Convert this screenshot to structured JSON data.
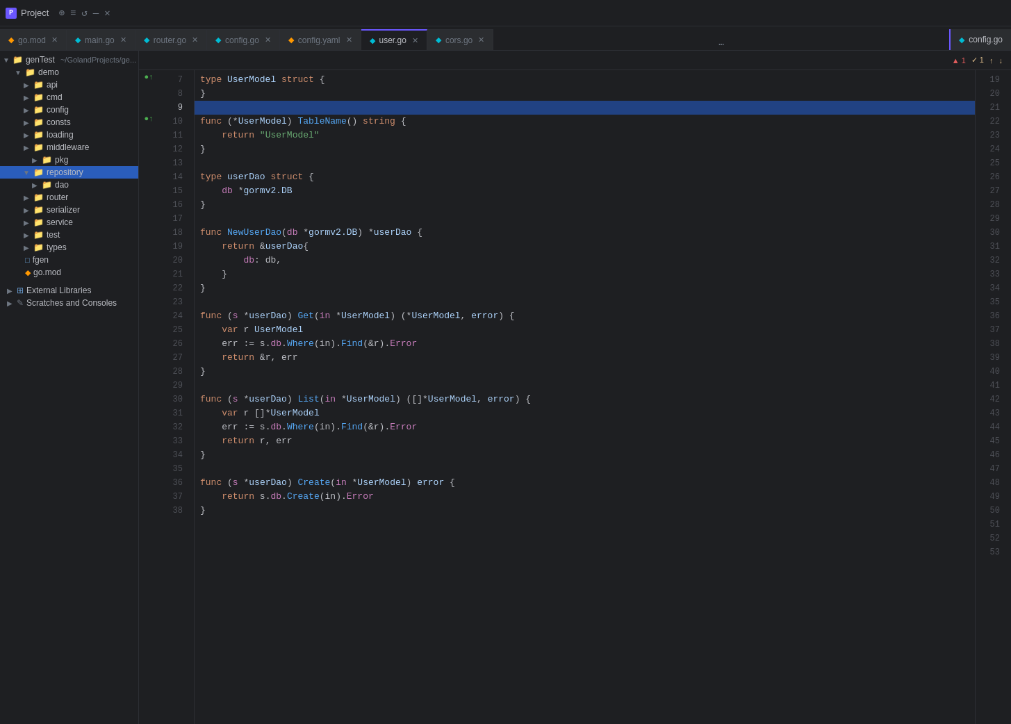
{
  "titleBar": {
    "projectIcon": "P",
    "projectLabel": "Project",
    "icons": [
      "globe",
      "list",
      "refresh",
      "minus",
      "x"
    ]
  },
  "tabs": [
    {
      "id": "go-mod",
      "label": "go.mod",
      "type": "mod",
      "active": false,
      "pinned": false
    },
    {
      "id": "main-go",
      "label": "main.go",
      "type": "go",
      "active": false,
      "pinned": false
    },
    {
      "id": "router-go",
      "label": "router.go",
      "type": "go",
      "active": false,
      "pinned": false
    },
    {
      "id": "config-go",
      "label": "config.go",
      "type": "go",
      "active": false,
      "pinned": false
    },
    {
      "id": "config-yaml",
      "label": "config.yaml",
      "type": "yaml",
      "active": false,
      "pinned": false
    },
    {
      "id": "user-go",
      "label": "user.go",
      "type": "go",
      "active": true,
      "pinned": false
    },
    {
      "id": "cors-go",
      "label": "cors.go",
      "type": "go",
      "active": false,
      "pinned": false
    }
  ],
  "pinnedTab": {
    "label": "config.go",
    "type": "go"
  },
  "toolbar": {
    "warningCount": "▲ 1",
    "checkCount": "✓ 1",
    "arrowUp": "↑",
    "arrowDown": "↓"
  },
  "sidebar": {
    "projectName": "genTest",
    "projectPath": "~/GolandProjects/ge...",
    "items": [
      {
        "id": "demo",
        "label": "demo",
        "type": "folder",
        "indent": 1,
        "expanded": true
      },
      {
        "id": "api",
        "label": "api",
        "type": "folder",
        "indent": 2,
        "expanded": false
      },
      {
        "id": "cmd",
        "label": "cmd",
        "type": "folder",
        "indent": 2,
        "expanded": false
      },
      {
        "id": "config",
        "label": "config",
        "type": "folder",
        "indent": 2,
        "expanded": false
      },
      {
        "id": "consts",
        "label": "consts",
        "type": "folder",
        "indent": 2,
        "expanded": false
      },
      {
        "id": "loading",
        "label": "loading",
        "type": "folder",
        "indent": 2,
        "expanded": false
      },
      {
        "id": "middleware",
        "label": "middleware",
        "type": "folder",
        "indent": 2,
        "expanded": false
      },
      {
        "id": "pkg",
        "label": "pkg",
        "type": "folder",
        "indent": 3,
        "expanded": false
      },
      {
        "id": "repository",
        "label": "repository",
        "type": "folder",
        "indent": 2,
        "expanded": true,
        "selected": true
      },
      {
        "id": "dao",
        "label": "dao",
        "type": "folder",
        "indent": 3,
        "expanded": false
      },
      {
        "id": "router",
        "label": "router",
        "type": "folder",
        "indent": 2,
        "expanded": false
      },
      {
        "id": "serializer",
        "label": "serializer",
        "type": "folder",
        "indent": 2,
        "expanded": false
      },
      {
        "id": "service",
        "label": "service",
        "type": "folder",
        "indent": 2,
        "expanded": false
      },
      {
        "id": "test",
        "label": "test",
        "type": "folder",
        "indent": 2,
        "expanded": false
      },
      {
        "id": "types",
        "label": "types",
        "type": "folder",
        "indent": 2,
        "expanded": false
      },
      {
        "id": "fgen",
        "label": "fgen",
        "type": "file",
        "indent": 1,
        "expanded": false
      },
      {
        "id": "go-mod-file",
        "label": "go.mod",
        "type": "mod-file",
        "indent": 1,
        "expanded": false
      }
    ],
    "externalLibraries": "External Libraries",
    "scratchesLabel": "Scratches and Consoles"
  },
  "code": {
    "lines": [
      {
        "num": 7,
        "gutter": "●↑",
        "content": "type UserModel struct {",
        "highlight": false,
        "fold": true
      },
      {
        "num": 8,
        "gutter": "",
        "content": "}",
        "highlight": false,
        "fold": false
      },
      {
        "num": 9,
        "gutter": "",
        "content": "",
        "highlight": true,
        "fold": false
      },
      {
        "num": 10,
        "gutter": "●↑",
        "content": "func (*UserModel) TableName() string {",
        "highlight": false,
        "fold": true
      },
      {
        "num": 11,
        "gutter": "",
        "content": "    return \"UserModel\"",
        "highlight": false,
        "fold": false
      },
      {
        "num": 12,
        "gutter": "",
        "content": "}",
        "highlight": false,
        "fold": true
      },
      {
        "num": 13,
        "gutter": "",
        "content": "",
        "highlight": false,
        "fold": false
      },
      {
        "num": 14,
        "gutter": "",
        "content": "type userDao struct {",
        "highlight": false,
        "fold": true
      },
      {
        "num": 15,
        "gutter": "",
        "content": "    db *gormv2.DB",
        "highlight": false,
        "fold": false
      },
      {
        "num": 16,
        "gutter": "",
        "content": "}",
        "highlight": false,
        "fold": true
      },
      {
        "num": 17,
        "gutter": "",
        "content": "",
        "highlight": false,
        "fold": false
      },
      {
        "num": 18,
        "gutter": "",
        "content": "func NewUserDao(db *gormv2.DB) *userDao {",
        "highlight": false,
        "fold": true
      },
      {
        "num": 19,
        "gutter": "",
        "content": "    return &userDao{",
        "highlight": false,
        "fold": true
      },
      {
        "num": 20,
        "gutter": "",
        "content": "        db: db,",
        "highlight": false,
        "fold": false
      },
      {
        "num": 21,
        "gutter": "",
        "content": "    }",
        "highlight": false,
        "fold": true
      },
      {
        "num": 22,
        "gutter": "",
        "content": "}",
        "highlight": false,
        "fold": true
      },
      {
        "num": 23,
        "gutter": "",
        "content": "",
        "highlight": false,
        "fold": false
      },
      {
        "num": 24,
        "gutter": "",
        "content": "func (s *userDao) Get(in *UserModel) (*UserModel, error) {",
        "highlight": false,
        "fold": true
      },
      {
        "num": 25,
        "gutter": "",
        "content": "    var r UserModel",
        "highlight": false,
        "fold": false
      },
      {
        "num": 26,
        "gutter": "",
        "content": "    err := s.db.Where(in).Find(&r).Error",
        "highlight": false,
        "fold": false
      },
      {
        "num": 27,
        "gutter": "",
        "content": "    return &r, err",
        "highlight": false,
        "fold": false
      },
      {
        "num": 28,
        "gutter": "",
        "content": "}",
        "highlight": false,
        "fold": true
      },
      {
        "num": 29,
        "gutter": "",
        "content": "",
        "highlight": false,
        "fold": false
      },
      {
        "num": 30,
        "gutter": "",
        "content": "func (s *userDao) List(in *UserModel) ([]*UserModel, error) {",
        "highlight": false,
        "fold": true
      },
      {
        "num": 31,
        "gutter": "",
        "content": "    var r []*UserModel",
        "highlight": false,
        "fold": false
      },
      {
        "num": 32,
        "gutter": "",
        "content": "    err := s.db.Where(in).Find(&r).Error",
        "highlight": false,
        "fold": false
      },
      {
        "num": 33,
        "gutter": "",
        "content": "    return r, err",
        "highlight": false,
        "fold": false
      },
      {
        "num": 34,
        "gutter": "",
        "content": "}",
        "highlight": false,
        "fold": true
      },
      {
        "num": 35,
        "gutter": "",
        "content": "",
        "highlight": false,
        "fold": false
      },
      {
        "num": 36,
        "gutter": "",
        "content": "func (s *userDao) Create(in *UserModel) error {",
        "highlight": false,
        "fold": true
      },
      {
        "num": 37,
        "gutter": "",
        "content": "    return s.db.Create(in).Error",
        "highlight": false,
        "fold": false
      },
      {
        "num": 38,
        "gutter": "",
        "content": "}",
        "highlight": false,
        "fold": true
      }
    ],
    "rightLineNums": [
      19,
      20,
      21,
      22,
      23,
      24,
      25,
      26,
      27,
      28,
      29,
      30,
      31,
      32,
      33,
      34,
      35,
      36,
      37,
      38,
      39,
      40,
      41,
      42,
      43,
      44,
      45,
      46,
      47,
      48,
      49,
      50,
      51,
      52,
      53
    ]
  }
}
